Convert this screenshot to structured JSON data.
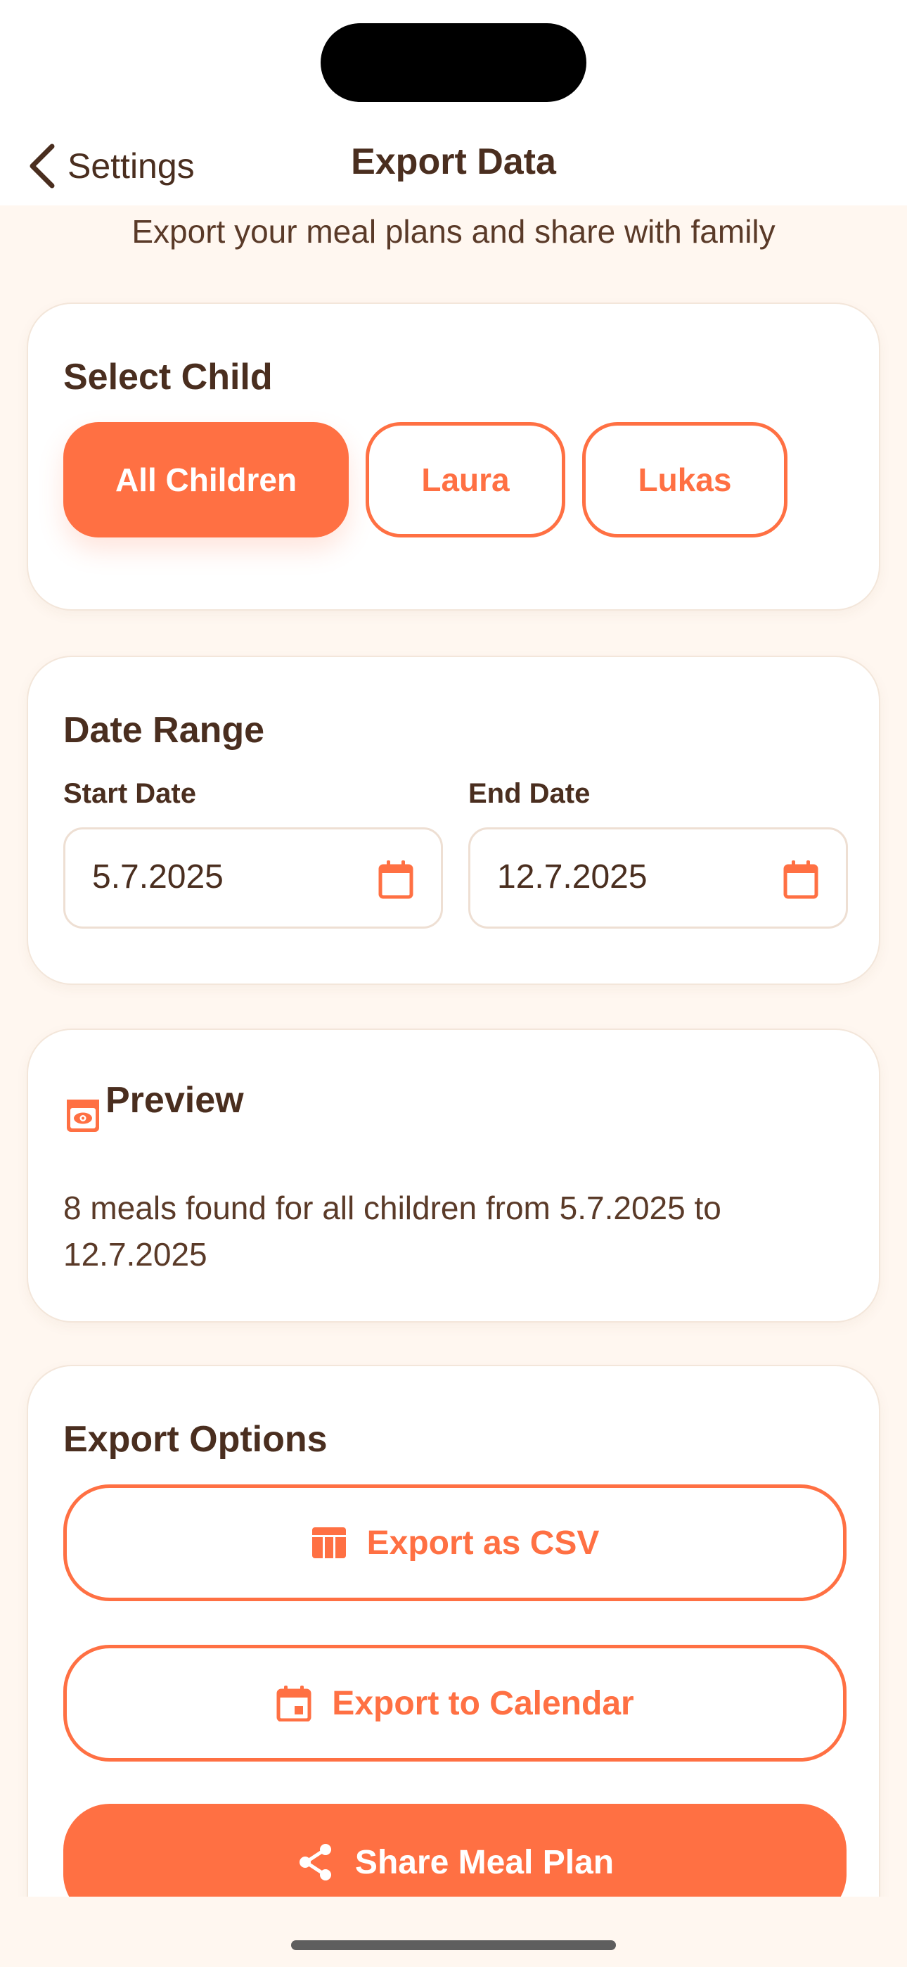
{
  "nav": {
    "back_label": "Settings",
    "title": "Export Data"
  },
  "subtitle": "Export your meal plans and share with family",
  "select_child": {
    "title": "Select Child",
    "chips": [
      {
        "label": "All Children",
        "selected": true
      },
      {
        "label": "Laura",
        "selected": false
      },
      {
        "label": "Lukas",
        "selected": false
      }
    ]
  },
  "date_range": {
    "title": "Date Range",
    "start_label": "Start Date",
    "start_value": "5.7.2025",
    "end_label": "End Date",
    "end_value": "12.7.2025"
  },
  "preview": {
    "title": "Preview",
    "text": "8 meals found for all children from 5.7.2025 to 12.7.2025"
  },
  "export_options": {
    "title": "Export Options",
    "csv_label": "Export as CSV",
    "calendar_label": "Export to Calendar",
    "share_label": "Share Meal Plan"
  },
  "colors": {
    "accent": "#ff7043",
    "text": "#4a2e1f",
    "background": "#fff7f0"
  },
  "icons": [
    "chevron-left-icon",
    "calendar-icon",
    "eye-icon",
    "table-icon",
    "calendar-icon",
    "share-icon"
  ]
}
